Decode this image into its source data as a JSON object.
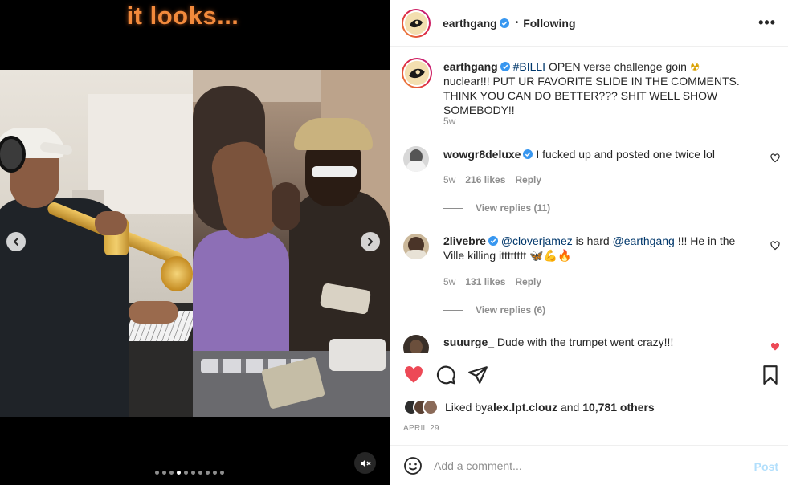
{
  "media": {
    "overlay_text": "it looks...",
    "carousel_count": 10,
    "carousel_active_index": 3
  },
  "header": {
    "username": "earthgang",
    "separator": "•",
    "follow_status": "Following",
    "more_icon": "more-horizontal-icon"
  },
  "caption": {
    "username": "earthgang",
    "hashtag": "#BILLI",
    "text_a": " OPEN verse challenge goin ",
    "emoji": "☢",
    "text_b": " nuclear!!! PUT UR FAVORITE SLIDE IN THE COMMENTS. THINK YOU CAN DO BETTER??? SHIT WELL SHOW SOMEBODY!!",
    "age": "5w"
  },
  "comments": [
    {
      "username": "wowgr8deluxe",
      "text": " I fucked up and posted one twice lol",
      "age": "5w",
      "likes": "216 likes",
      "reply": "Reply",
      "view_replies": "View replies (11)"
    },
    {
      "username": "2livebre",
      "mention1": "@cloverjamez",
      "text_a": " is hard ",
      "mention2": "@earthgang",
      "text_b": " !!! He in the Ville killing itttttttt 🦋💪🔥",
      "age": "5w",
      "likes": "131 likes",
      "reply": "Reply",
      "view_replies": "View replies (6)"
    },
    {
      "username": "suuurge_",
      "text": " Dude with the trumpet went crazy!!!"
    }
  ],
  "actions": {
    "liked_by_prefix": "Liked by ",
    "liked_by_user": "alex.lpt.clouz",
    "liked_by_and": " and ",
    "liked_by_count": "10,781 others",
    "date": "APRIL 29"
  },
  "composer": {
    "placeholder": "Add a comment...",
    "post_label": "Post"
  },
  "colors": {
    "like_red": "#ed4956",
    "verified_blue": "#3897f0",
    "link_blue": "#00376b",
    "muted_gray": "#8e8e8e",
    "post_disabled": "#b2dffc"
  }
}
